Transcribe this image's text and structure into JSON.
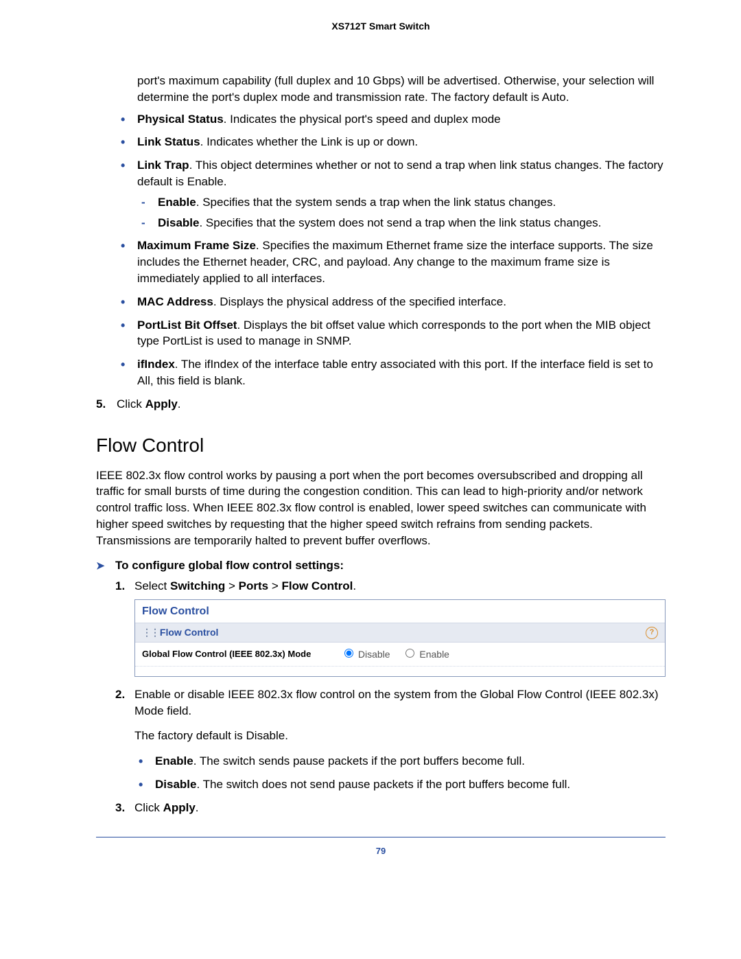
{
  "header": {
    "product": "XS712T Smart Switch"
  },
  "continuation_para": "port's maximum capability (full duplex and 10 Gbps) will be advertised. Otherwise, your selection will determine the port's duplex mode and transmission rate. The factory default is Auto.",
  "port_bullets": [
    {
      "label": "Physical Status",
      "text": ". Indicates the physical port's speed and duplex mode"
    },
    {
      "label": "Link Status",
      "text": ". Indicates whether the Link is up or down."
    },
    {
      "label": "Link Trap",
      "text": ". This object determines whether or not to send a trap when link status changes. The factory default is Enable.",
      "sub": [
        {
          "label": "Enable",
          "text": ". Specifies that the system sends a trap when the link status changes."
        },
        {
          "label": "Disable",
          "text": ". Specifies that the system does not send a trap when the link status changes."
        }
      ]
    },
    {
      "label": "Maximum Frame Size",
      "text": ". Specifies the maximum Ethernet frame size the interface supports. The size includes the Ethernet header, CRC, and payload. Any change to the maximum frame size is immediately applied to all interfaces."
    },
    {
      "label": "MAC Address",
      "text": ". Displays the physical address of the specified interface."
    },
    {
      "label": "PortList Bit Offset",
      "text": ". Displays the bit offset value which corresponds to the port when the MIB object type PortList is used to manage in SNMP."
    },
    {
      "label": "ifIndex",
      "text": ". The ifIndex of the interface table entry associated with this port. If the interface field is set to All, this field is blank."
    }
  ],
  "step5": {
    "num": "5.",
    "pre": "Click ",
    "bold": "Apply",
    "post": "."
  },
  "flow": {
    "heading": "Flow Control",
    "intro": "IEEE 802.3x flow control works by pausing a port when the port becomes oversubscribed and dropping all traffic for small bursts of time during the congestion condition. This can lead to high-priority and/or network control traffic loss. When IEEE 802.3x flow control is enabled, lower speed switches can communicate with higher speed switches by requesting that the higher speed switch refrains from sending packets. Transmissions are temporarily halted to prevent buffer overflows.",
    "proc_title": "To configure global flow control settings:",
    "step1": {
      "num": "1.",
      "pre": "Select ",
      "b1": "Switching",
      "s1": " > ",
      "b2": "Ports",
      "s2": " > ",
      "b3": "Flow Control",
      "post": "."
    },
    "panel": {
      "title": "Flow Control",
      "section": "Flow Control",
      "row_label": "Global Flow Control (IEEE 802.3x) Mode",
      "opt_disable": "Disable",
      "opt_enable": "Enable",
      "help": "?"
    },
    "step2_a": "Enable or disable IEEE 802.3x flow control on the system from the Global Flow Control (IEEE 802.3x) Mode field.",
    "step2_b": "The factory default is Disable.",
    "step2_bullets": [
      {
        "label": "Enable",
        "text": ". The switch sends pause packets if the port buffers become full."
      },
      {
        "label": "Disable",
        "text": ". The switch does not send pause packets if the port buffers become full."
      }
    ],
    "step2_num": "2.",
    "step3": {
      "num": "3.",
      "pre": "Click ",
      "bold": "Apply",
      "post": "."
    }
  },
  "footer": {
    "page": "79"
  }
}
